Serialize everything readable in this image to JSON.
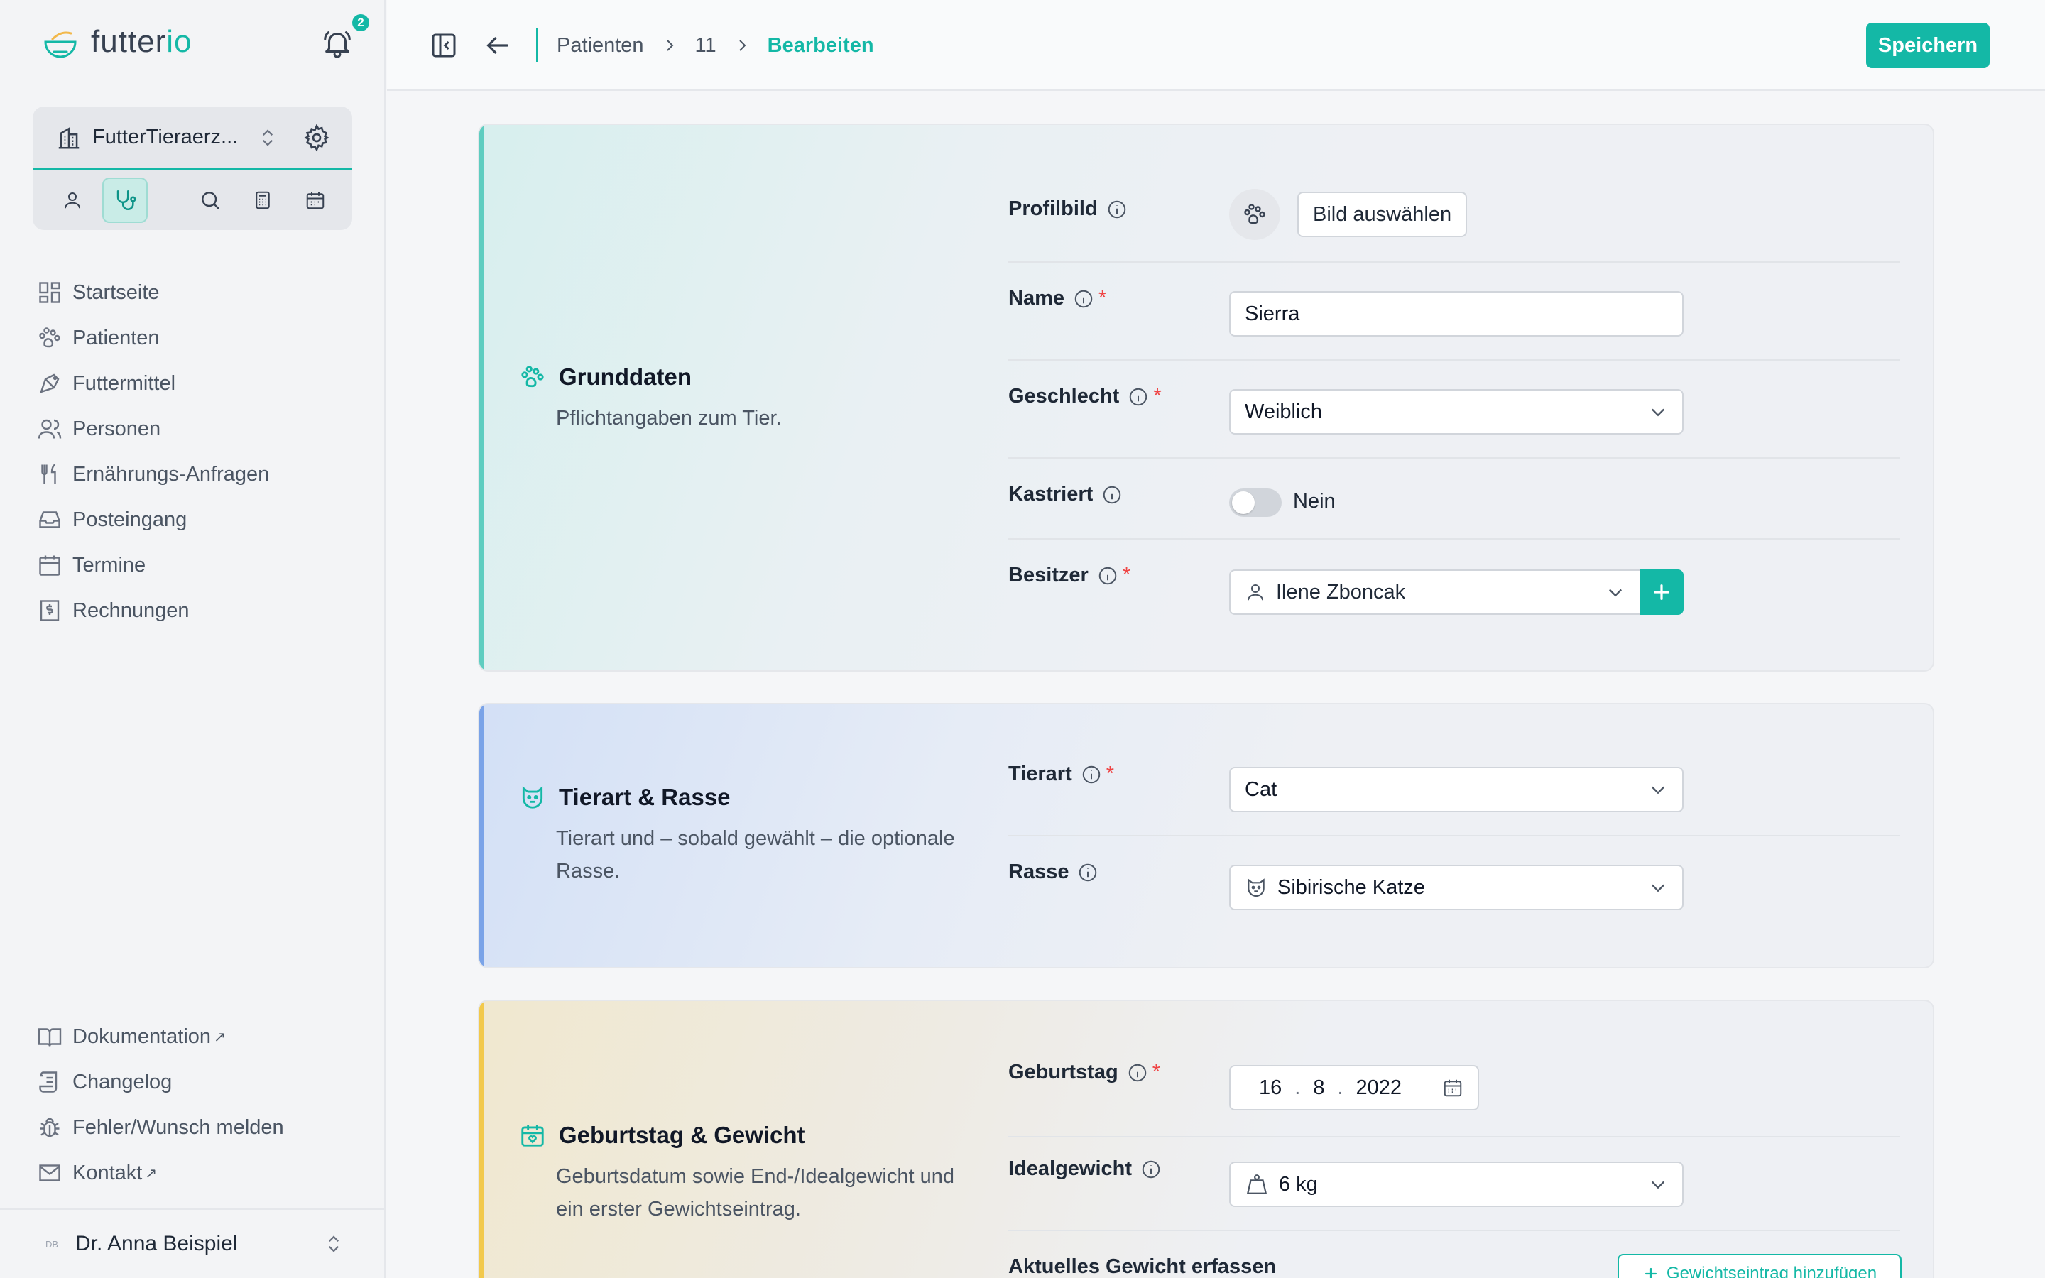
{
  "app": {
    "logo_prefix": "futter",
    "logo_accent": "io",
    "notification_count": "2"
  },
  "org": {
    "name": "FutterTieraerz..."
  },
  "sidebar": {
    "items": [
      {
        "label": "Startseite"
      },
      {
        "label": "Patienten"
      },
      {
        "label": "Futtermittel"
      },
      {
        "label": "Personen"
      },
      {
        "label": "Ernährungs-Anfragen"
      },
      {
        "label": "Posteingang"
      },
      {
        "label": "Termine"
      },
      {
        "label": "Rechnungen"
      }
    ],
    "bottom_items": [
      {
        "label": "Dokumentation",
        "external": "↗"
      },
      {
        "label": "Changelog"
      },
      {
        "label": "Fehler/Wunsch melden"
      },
      {
        "label": "Kontakt",
        "external": "↗"
      }
    ]
  },
  "user": {
    "initials": "DB",
    "name": "Dr. Anna Beispiel"
  },
  "header": {
    "breadcrumbs": [
      "Patienten",
      "11",
      "Bearbeiten"
    ],
    "save_label": "Speichern"
  },
  "sections": {
    "basic": {
      "title": "Grunddaten",
      "description": "Pflichtangaben zum Tier.",
      "profile_label": "Profilbild",
      "choose_image": "Bild auswählen",
      "name_label": "Name",
      "name_value": "Sierra",
      "sex_label": "Geschlecht",
      "sex_value": "Weiblich",
      "neutered_label": "Kastriert",
      "neutered_value": "Nein",
      "owner_label": "Besitzer",
      "owner_value": "Ilene Zboncak"
    },
    "species": {
      "title": "Tierart & Rasse",
      "description": "Tierart und – sobald gewählt – die optionale Rasse.",
      "species_label": "Tierart",
      "species_value": "Cat",
      "breed_label": "Rasse",
      "breed_value": "Sibirische Katze"
    },
    "birth": {
      "title": "Geburtstag & Gewicht",
      "description": "Geburtsdatum sowie End-/Idealgewicht und ein erster Gewichtseintrag.",
      "birthday_label": "Geburtstag",
      "day": "16",
      "month": "8",
      "year": "2022",
      "ideal_label": "Idealgewicht",
      "ideal_value": "6 kg",
      "current_label": "Aktuelles Gewicht erfassen",
      "add_entry": "Gewichtseintrag hinzufügen"
    }
  },
  "colors": {
    "accent": "#14b8a6",
    "required": "#ef4444"
  }
}
